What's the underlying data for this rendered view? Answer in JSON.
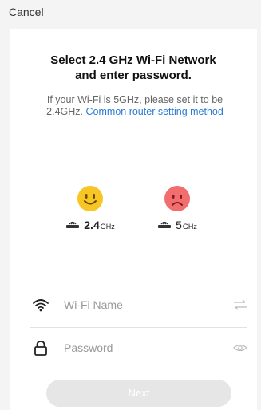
{
  "header": {
    "cancel_label": "Cancel"
  },
  "title": {
    "line1": "Select 2.4 GHz Wi-Fi Network",
    "line2": "and enter password."
  },
  "description": {
    "text": "If your Wi-Fi is 5GHz, please set it to be 2.4GHz.",
    "link": "Common router setting method"
  },
  "bands": [
    {
      "value": "2.4",
      "unit": "GHz",
      "face": "happy-face-icon",
      "color": "#f7c624"
    },
    {
      "value": "5",
      "unit": "GHz",
      "face": "sad-face-icon",
      "color": "#f26e6e"
    }
  ],
  "form": {
    "wifi_placeholder": "Wi-Fi Name",
    "password_placeholder": "Password"
  },
  "next_label": "Next",
  "icons": [
    "wifi-icon",
    "swap-icon",
    "lock-icon",
    "eye-icon",
    "router-icon"
  ]
}
